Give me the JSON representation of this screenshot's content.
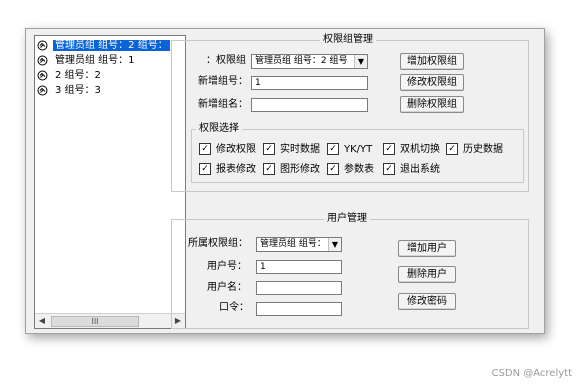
{
  "tree": {
    "items": [
      {
        "label": "管理员组  组号：2  组号：",
        "selected": true
      },
      {
        "label": "管理员组  组号：1",
        "selected": false
      },
      {
        "label": "2  组号：2",
        "selected": false
      },
      {
        "label": "3  组号：3",
        "selected": false
      }
    ],
    "scroll_thumb": "III"
  },
  "permission_group": {
    "title": "权限组管理",
    "group_label": "：权限组",
    "group_select_value": "管理员组  组号：2  组号",
    "new_no_label": "新增组号：",
    "new_no_value": "1",
    "new_name_label": "新增组名：",
    "new_name_value": "",
    "add_button": "增加权限组",
    "modify_button": "修改权限组",
    "delete_button": "删除权限组"
  },
  "permission_select": {
    "title": "权限选择",
    "options": [
      {
        "label": "修改权限",
        "checked": true
      },
      {
        "label": "实时数据",
        "checked": true
      },
      {
        "label": "YK/YT",
        "checked": true
      },
      {
        "label": "双机切换",
        "checked": true
      },
      {
        "label": "历史数据",
        "checked": true
      },
      {
        "label": "报表修改",
        "checked": true
      },
      {
        "label": "图形修改",
        "checked": true
      },
      {
        "label": "参数表",
        "checked": true
      },
      {
        "label": "退出系统",
        "checked": true
      }
    ]
  },
  "user_mgmt": {
    "title": "用户管理",
    "group_label": "所属权限组：",
    "group_select_value": "管理员组  组号：",
    "user_no_label": "用户号：",
    "user_no_value": "1",
    "user_name_label": "用户名：",
    "user_name_value": "",
    "password_label": "口令：",
    "password_value": "",
    "add_button": "增加用户",
    "delete_button": "删除用户",
    "change_pw_button": "修改密码"
  },
  "watermark": "CSDN @Acrelytt"
}
